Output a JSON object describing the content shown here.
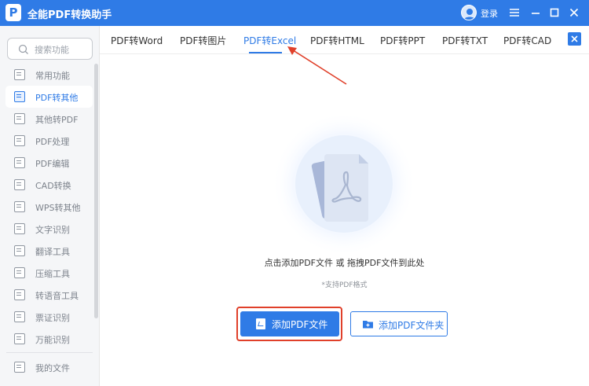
{
  "app": {
    "title": "全能PDF转换助手",
    "logo_letter": "P",
    "login_label": "登录"
  },
  "window_controls": [
    "menu-icon",
    "minimize-icon",
    "maximize-icon",
    "close-icon"
  ],
  "search": {
    "placeholder": "搜索功能"
  },
  "sidebar": {
    "items": [
      {
        "label": "常用功能",
        "icon": "star-doc-icon",
        "active": false
      },
      {
        "label": "PDF转其他",
        "icon": "pdf-export-icon",
        "active": true
      },
      {
        "label": "其他转PDF",
        "icon": "to-pdf-icon",
        "active": false
      },
      {
        "label": "PDF处理",
        "icon": "pdf-process-icon",
        "active": false
      },
      {
        "label": "PDF编辑",
        "icon": "pdf-edit-icon",
        "active": false
      },
      {
        "label": "CAD转换",
        "icon": "cad-icon",
        "active": false
      },
      {
        "label": "WPS转其他",
        "icon": "wps-icon",
        "active": false
      },
      {
        "label": "文字识别",
        "icon": "ocr-icon",
        "active": false
      },
      {
        "label": "翻译工具",
        "icon": "translate-icon",
        "active": false
      },
      {
        "label": "压缩工具",
        "icon": "compress-icon",
        "active": false
      },
      {
        "label": "转语音工具",
        "icon": "voice-icon",
        "active": false
      },
      {
        "label": "票证识别",
        "icon": "ticket-icon",
        "active": false
      },
      {
        "label": "万能识别",
        "icon": "scan-icon",
        "active": false
      }
    ],
    "bottom_item": {
      "label": "我的文件",
      "icon": "my-files-icon"
    }
  },
  "tabs": [
    {
      "label": "PDF转Word",
      "active": false
    },
    {
      "label": "PDF转图片",
      "active": false
    },
    {
      "label": "PDF转Excel",
      "active": true
    },
    {
      "label": "PDF转HTML",
      "active": false
    },
    {
      "label": "PDF转PPT",
      "active": false
    },
    {
      "label": "PDF转TXT",
      "active": false
    },
    {
      "label": "PDF转CAD",
      "active": false
    }
  ],
  "drop_zone": {
    "instruction": "点击添加PDF文件 或 拖拽PDF文件到此处",
    "hint": "*支持PDF格式",
    "add_file_button": "添加PDF文件",
    "add_folder_button": "添加PDF文件夹"
  },
  "colors": {
    "accent": "#2f7be6",
    "annotation": "#e0402a"
  }
}
